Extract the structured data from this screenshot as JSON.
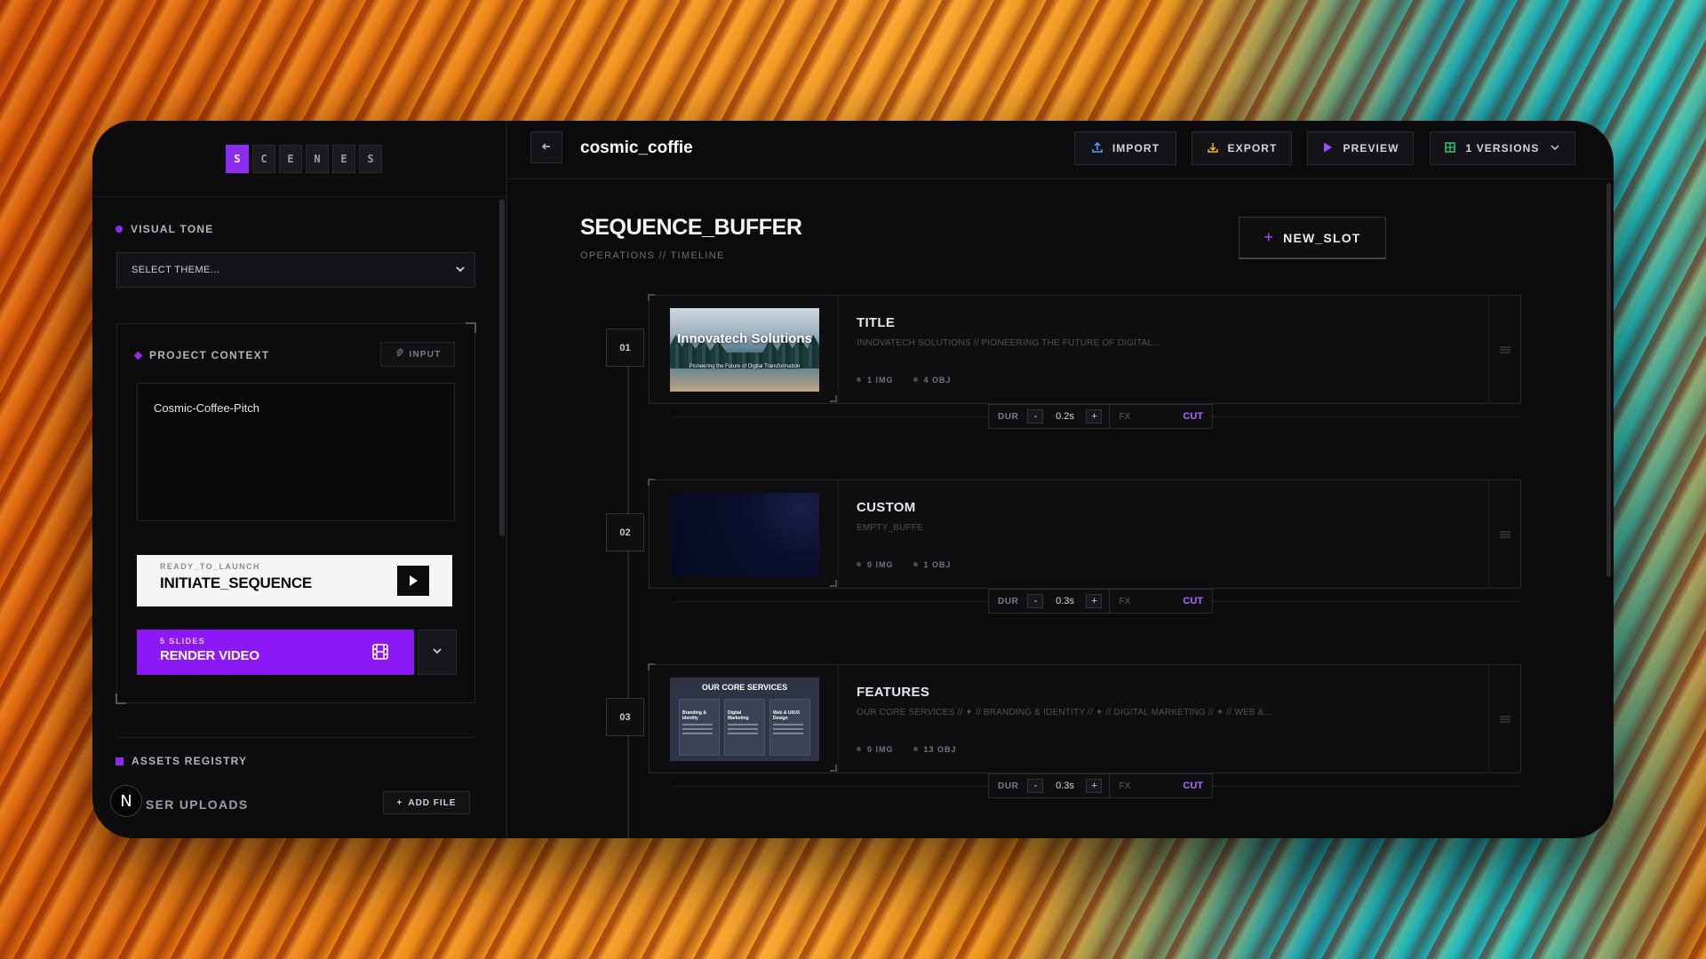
{
  "brand": {
    "letters": [
      "S",
      "C",
      "E",
      "N",
      "E",
      "S"
    ]
  },
  "sidebar": {
    "visual_tone": {
      "title": "VISUAL TONE",
      "select_value": "SELECT THEME..."
    },
    "project_context": {
      "title": "PROJECT CONTEXT",
      "input_label": "INPUT",
      "text": "Cosmic-Coffee-Pitch"
    },
    "launch": {
      "kicker": "READY_TO_LAUNCH",
      "label": "INITIATE_SEQUENCE"
    },
    "render": {
      "kicker": "5 SLIDES",
      "label": "RENDER VIDEO"
    },
    "assets": {
      "title": "ASSETS REGISTRY",
      "uploads": "SER UPLOADS",
      "add_file": "ADD FILE",
      "badge": "N"
    }
  },
  "topbar": {
    "project_name": "cosmic_coffie",
    "import": "IMPORT",
    "export": "EXPORT",
    "preview": "PREVIEW",
    "versions": "1 VERSIONS"
  },
  "main": {
    "title": "SEQUENCE_BUFFER",
    "subtitle": "OPERATIONS // TIMELINE",
    "new_slot": "NEW_SLOT",
    "slots": [
      {
        "index": "01",
        "name": "TITLE",
        "desc": "INNOVATECH SOLUTIONS // PIONEERING THE FUTURE OF DIGITAL...",
        "img": "1 IMG",
        "obj": "4 OBJ",
        "thumb_title": "Innovatech Solutions",
        "thumb_tagline": "Pioneering the Future of Digital Transformation"
      },
      {
        "index": "02",
        "name": "CUSTOM",
        "desc": "EMPTY_BUFFE",
        "img": "0 IMG",
        "obj": "1 OBJ"
      },
      {
        "index": "03",
        "name": "FEATURES",
        "desc": "OUR CORE SERVICES // ✦ // BRANDING & IDENTITY // ✦ // DIGITAL MARKETING // ✦ // WEB &...",
        "img": "0 IMG",
        "obj": "13 OBJ",
        "thumb_title": "OUR CORE SERVICES",
        "thumb_cols": [
          "Branding & Identity",
          "Digital Marketing",
          "Web & UI/UX Design"
        ]
      }
    ],
    "transitions": [
      {
        "dur_label": "DUR",
        "minus": "-",
        "value": "0.2s",
        "plus": "+",
        "fx_label": "FX",
        "effect": "CUT"
      },
      {
        "dur_label": "DUR",
        "minus": "-",
        "value": "0.3s",
        "plus": "+",
        "fx_label": "FX",
        "effect": "CUT"
      },
      {
        "dur_label": "DUR",
        "minus": "-",
        "value": "0.3s",
        "plus": "+",
        "fx_label": "FX",
        "effect": "CUT"
      }
    ]
  },
  "colors": {
    "accent": "#8b18f5",
    "accent_text": "#b069ff",
    "panel": "#0b0b0d"
  }
}
